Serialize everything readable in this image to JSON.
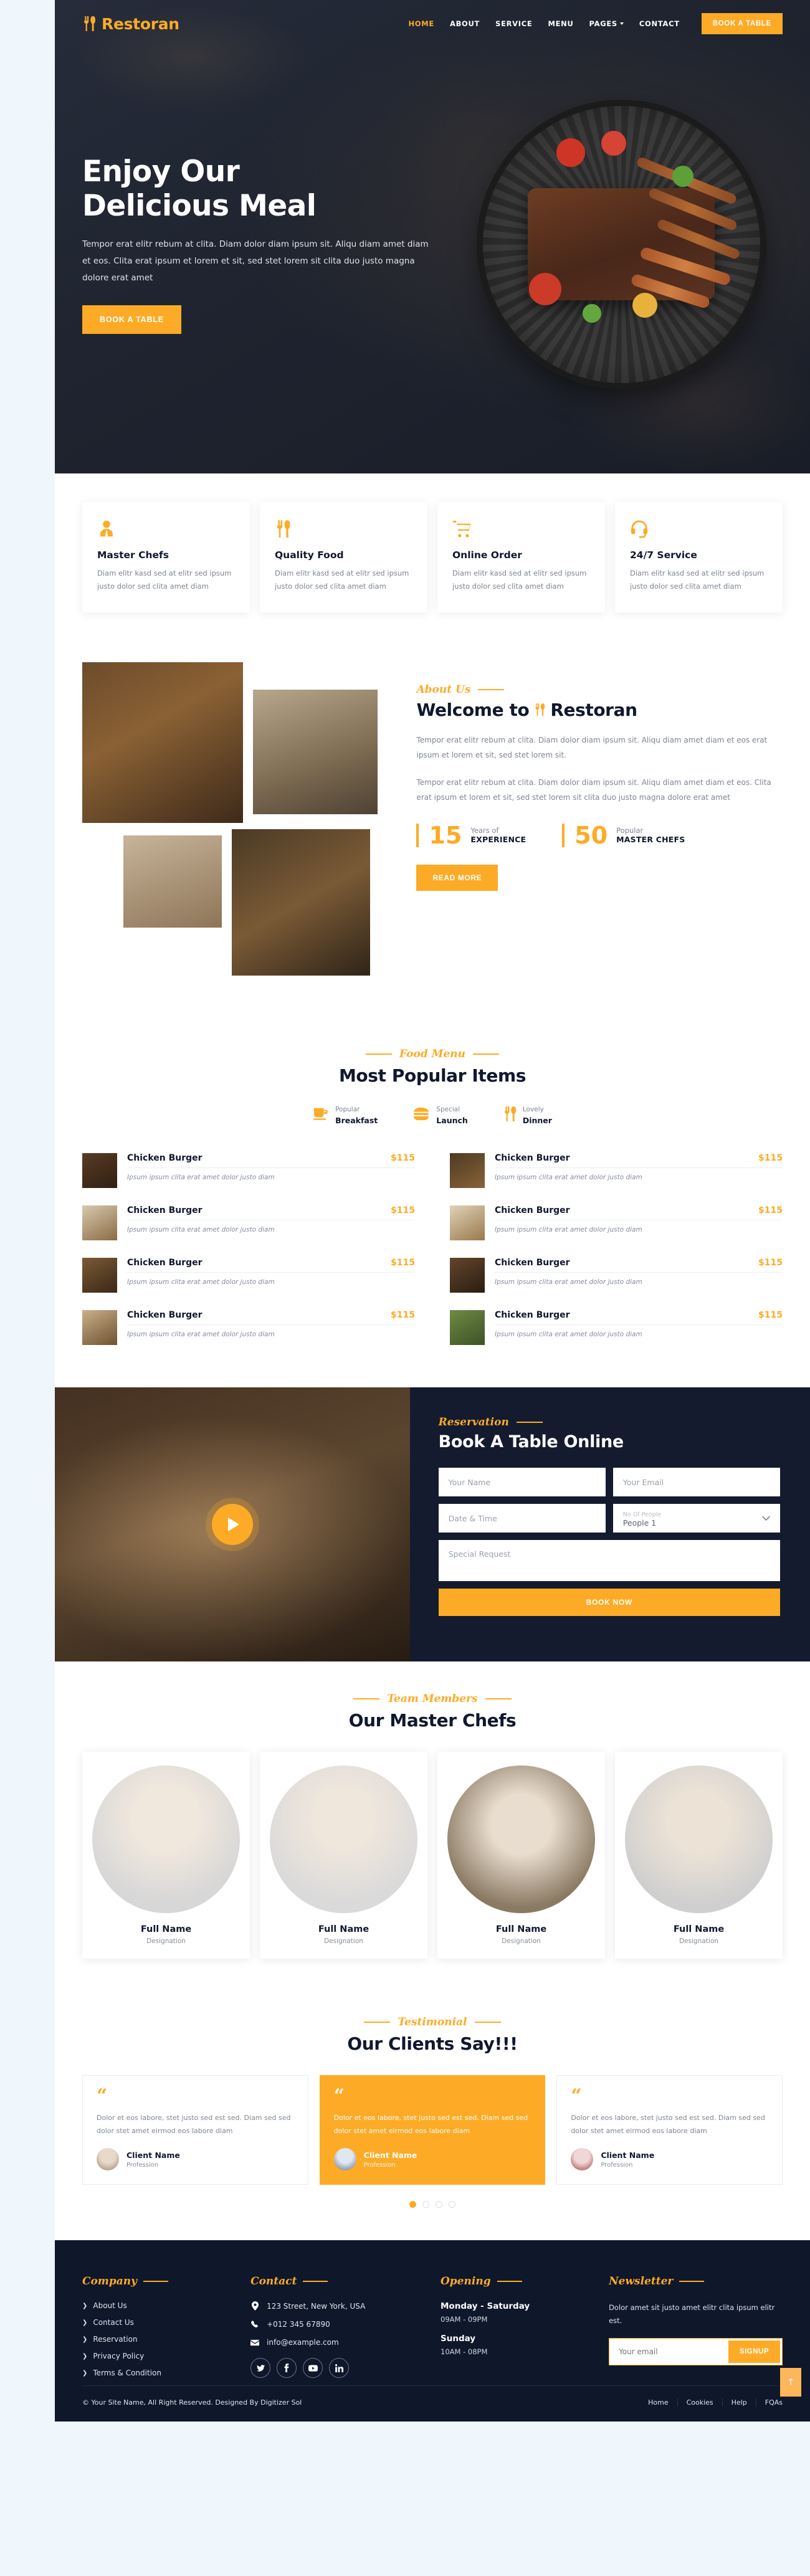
{
  "brand": {
    "name": "Restoran",
    "icon": "fork-knife-icon"
  },
  "nav": {
    "links": [
      {
        "label": "HOME",
        "active": true
      },
      {
        "label": "ABOUT",
        "active": false
      },
      {
        "label": "SERVICE",
        "active": false
      },
      {
        "label": "MENU",
        "active": false
      },
      {
        "label": "PAGES",
        "active": false,
        "caret": true
      },
      {
        "label": "CONTACT",
        "active": false
      }
    ],
    "cta": "BOOK A TABLE"
  },
  "hero": {
    "title_line1": "Enjoy Our",
    "title_line2": "Delicious Meal",
    "paragraph": "Tempor erat elitr rebum at clita. Diam dolor diam ipsum sit. Aliqu diam amet diam et eos. Clita erat ipsum et lorem et sit, sed stet lorem sit clita duo justo magna dolore erat amet",
    "cta": "BOOK A TABLE"
  },
  "features": [
    {
      "icon": "chef-icon",
      "title": "Master Chefs",
      "text": "Diam elitr kasd sed at elitr sed ipsum justo dolor sed clita amet diam"
    },
    {
      "icon": "fork-knife-icon",
      "title": "Quality Food",
      "text": "Diam elitr kasd sed at elitr sed ipsum justo dolor sed clita amet diam"
    },
    {
      "icon": "cart-plus-icon",
      "title": "Online Order",
      "text": "Diam elitr kasd sed at elitr sed ipsum justo dolor sed clita amet diam"
    },
    {
      "icon": "headset-icon",
      "title": "24/7 Service",
      "text": "Diam elitr kasd sed at elitr sed ipsum justo dolor sed clita amet diam"
    }
  ],
  "about": {
    "eyebrow": "About Us",
    "heading_before": "Welcome to",
    "heading_after": "Restoran",
    "paragraph1": "Tempor erat elitr rebum at clita. Diam dolor diam ipsum sit. Aliqu diam amet diam et eos erat ipsum et lorem et sit, sed stet lorem sit.",
    "paragraph2": "Tempor erat elitr rebum at clita. Diam dolor diam ipsum sit. Aliqu diam amet diam et eos. Clita erat ipsum et lorem et sit, sed stet lorem sit clita duo justo magna dolore erat amet",
    "stats": [
      {
        "number": "15",
        "top": "Years of",
        "bottom": "EXPERIENCE"
      },
      {
        "number": "50",
        "top": "Popular",
        "bottom": "MASTER CHEFS"
      }
    ],
    "cta": "READ MORE"
  },
  "menu": {
    "eyebrow": "Food Menu",
    "title": "Most Popular Items",
    "tabs": [
      {
        "icon": "coffee-cup-icon",
        "small": "Popular",
        "large": "Breakfast",
        "active": true
      },
      {
        "icon": "burger-icon",
        "small": "Special",
        "large": "Launch",
        "active": false
      },
      {
        "icon": "fork-knife-icon",
        "small": "Lovely",
        "large": "Dinner",
        "active": false
      }
    ],
    "items": [
      {
        "name": "Chicken Burger",
        "price": "$115",
        "desc": "Ipsum ipsum clita erat amet dolor justo diam"
      },
      {
        "name": "Chicken Burger",
        "price": "$115",
        "desc": "Ipsum ipsum clita erat amet dolor justo diam"
      },
      {
        "name": "Chicken Burger",
        "price": "$115",
        "desc": "Ipsum ipsum clita erat amet dolor justo diam"
      },
      {
        "name": "Chicken Burger",
        "price": "$115",
        "desc": "Ipsum ipsum clita erat amet dolor justo diam"
      },
      {
        "name": "Chicken Burger",
        "price": "$115",
        "desc": "Ipsum ipsum clita erat amet dolor justo diam"
      },
      {
        "name": "Chicken Burger",
        "price": "$115",
        "desc": "Ipsum ipsum clita erat amet dolor justo diam"
      },
      {
        "name": "Chicken Burger",
        "price": "$115",
        "desc": "Ipsum ipsum clita erat amet dolor justo diam"
      },
      {
        "name": "Chicken Burger",
        "price": "$115",
        "desc": "Ipsum ipsum clita erat amet dolor justo diam"
      }
    ]
  },
  "reservation": {
    "eyebrow": "Reservation",
    "title": "Book A Table Online",
    "name_placeholder": "Your Name",
    "email_placeholder": "Your Email",
    "datetime_placeholder": "Date & Time",
    "people_label": "No Of People",
    "people_value": "People 1",
    "request_placeholder": "Special Request",
    "cta": "BOOK NOW"
  },
  "team": {
    "eyebrow": "Team Members",
    "title": "Our Master Chefs",
    "members": [
      {
        "name": "Full Name",
        "role": "Designation"
      },
      {
        "name": "Full Name",
        "role": "Designation"
      },
      {
        "name": "Full Name",
        "role": "Designation"
      },
      {
        "name": "Full Name",
        "role": "Designation"
      }
    ]
  },
  "testimonial": {
    "eyebrow": "Testimonial",
    "title": "Our Clients Say!!!",
    "quote_glyph": "“",
    "cards": [
      {
        "text": "Dolor et eos labore, stet justo sed est sed. Diam sed sed dolor stet amet eirmod eos labore diam",
        "name": "Client Name",
        "profession": "Profession",
        "active": false
      },
      {
        "text": "Dolor et eos labore, stet justo sed est sed. Diam sed sed dolor stet amet eirmod eos labore diam",
        "name": "Client Name",
        "profession": "Profession",
        "active": true
      },
      {
        "text": "Dolor et eos labore, stet justo sed est sed. Diam sed sed dolor stet amet eirmod eos labore diam",
        "name": "Client Name",
        "profession": "Profession",
        "active": false
      }
    ],
    "dots": [
      true,
      false,
      false,
      false
    ]
  },
  "footer": {
    "company": {
      "title": "Company",
      "links": [
        "About Us",
        "Contact Us",
        "Reservation",
        "Privacy Policy",
        "Terms & Condition"
      ]
    },
    "contact": {
      "title": "Contact",
      "address": "123 Street, New York, USA",
      "phone": "+012 345 67890",
      "email": "info@example.com",
      "socials": [
        "twitter-icon",
        "facebook-icon",
        "youtube-icon",
        "linkedin-icon"
      ]
    },
    "opening": {
      "title": "Opening",
      "rows": [
        {
          "day": "Monday - Saturday",
          "time": "09AM - 09PM"
        },
        {
          "day": "Sunday",
          "time": "10AM - 08PM"
        }
      ]
    },
    "newsletter": {
      "title": "Newsletter",
      "text": "Dolor amet sit justo amet elitr clita ipsum elitr est.",
      "placeholder": "Your email",
      "button": "SIGNUP"
    },
    "copyright": "© Your Site Name, All Right Reserved. Designed By Digitizer Sol",
    "bottom_links": [
      "Home",
      "Cookies",
      "Help",
      "FQAs"
    ],
    "to_top": "↑"
  },
  "colors": {
    "accent": "#fdab26",
    "dark": "#0f172b",
    "page_bg": "#eff6fc"
  }
}
